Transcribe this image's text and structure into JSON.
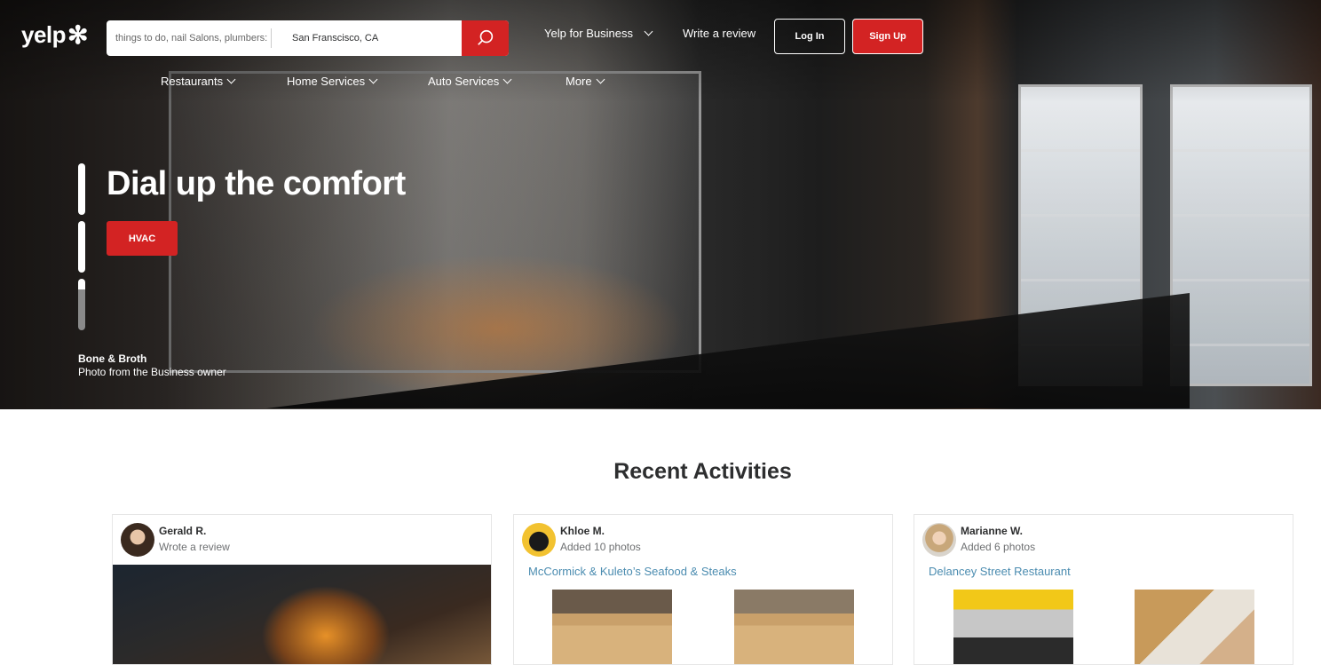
{
  "header": {
    "logo_text": "yelp",
    "search_find_placeholder": "things to do, nail Salons, plumbers:",
    "search_near_value": "San Franscisco, CA",
    "yelp_for_business": "Yelp for Business",
    "write_review": "Write a review",
    "login": "Log In",
    "signup": "Sign Up"
  },
  "categories": [
    "Restaurants",
    "Home Services",
    "Auto Services",
    "More"
  ],
  "hero": {
    "headline": "Dial up the comfort",
    "cta": "HVAC",
    "business": "Bone & Broth",
    "credit": "Photo from the Business owner"
  },
  "recent": {
    "title": "Recent Activities",
    "cards": [
      {
        "name": "Gerald R.",
        "action": "Wrote a review",
        "business": ""
      },
      {
        "name": "Khloe M.",
        "action": "Added 10 photos",
        "business": "McCormick & Kuleto’s Seafood & Steaks"
      },
      {
        "name": "Marianne W.",
        "action": "Added 6 photos",
        "business": "Delancey Street Restaurant"
      }
    ]
  },
  "colors": {
    "brand_red": "#d32323",
    "link_blue": "#4b8cb0"
  }
}
